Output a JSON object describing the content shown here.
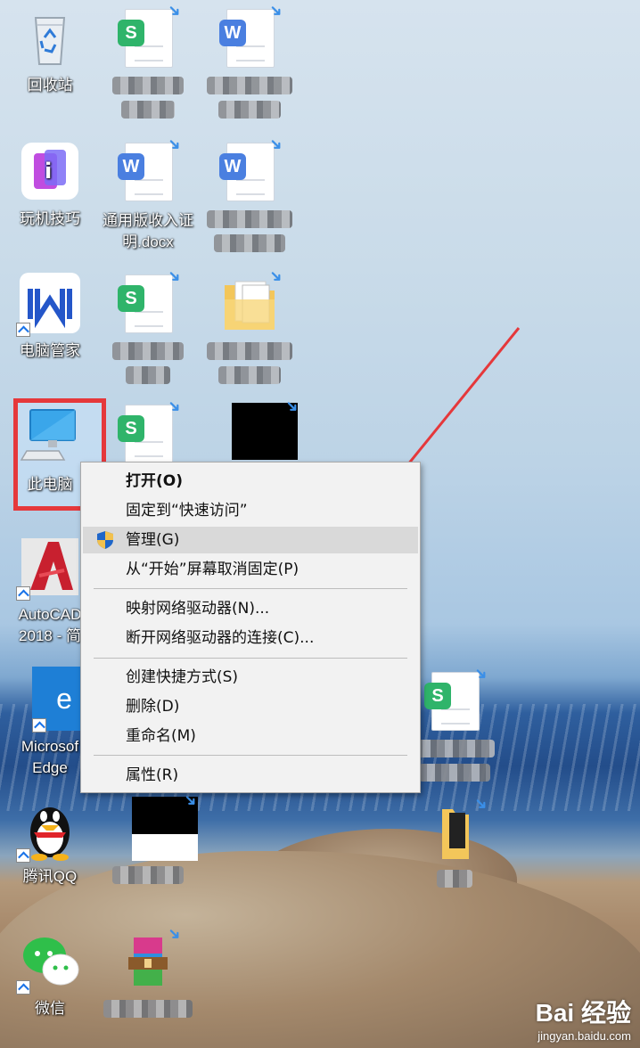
{
  "desktop": {
    "icons": [
      {
        "name": "recycle-bin",
        "label": "回收站"
      },
      {
        "name": "fun-tips",
        "label": "玩机技巧"
      },
      {
        "name": "pc-manager",
        "label": "电脑管家"
      },
      {
        "name": "this-pc",
        "label": "此电脑"
      },
      {
        "name": "autocad",
        "label_line1": "AutoCAD",
        "label_line2": "2018 - 简"
      },
      {
        "name": "edge",
        "label_line1": "Microsof",
        "label_line2": "Edge"
      },
      {
        "name": "qq",
        "label": "腾讯QQ"
      },
      {
        "name": "wechat",
        "label": "微信"
      },
      {
        "name": "income-doc",
        "label_line1": "通用版收入证",
        "label_line2": "明.docx"
      }
    ],
    "doc_badges": {
      "sheet": "S",
      "word": "W",
      "edge": "e"
    }
  },
  "context_menu": {
    "items": [
      {
        "label": "打开(O)"
      },
      {
        "label": "固定到“快速访问”"
      },
      {
        "label": "管理(G)"
      },
      {
        "label": "从“开始”屏幕取消固定(P)"
      },
      {
        "label": "映射网络驱动器(N)..."
      },
      {
        "label": "断开网络驱动器的连接(C)..."
      },
      {
        "label": "创建快捷方式(S)"
      },
      {
        "label": "删除(D)"
      },
      {
        "label": "重命名(M)"
      },
      {
        "label": "属性(R)"
      }
    ]
  },
  "watermark": {
    "brand": "Bai 经验",
    "site": "jingyan.baidu.com"
  },
  "colors": {
    "highlight_box": "#e5383b",
    "arrow": "#e5383b",
    "menu_bg": "#f2f2f2"
  }
}
